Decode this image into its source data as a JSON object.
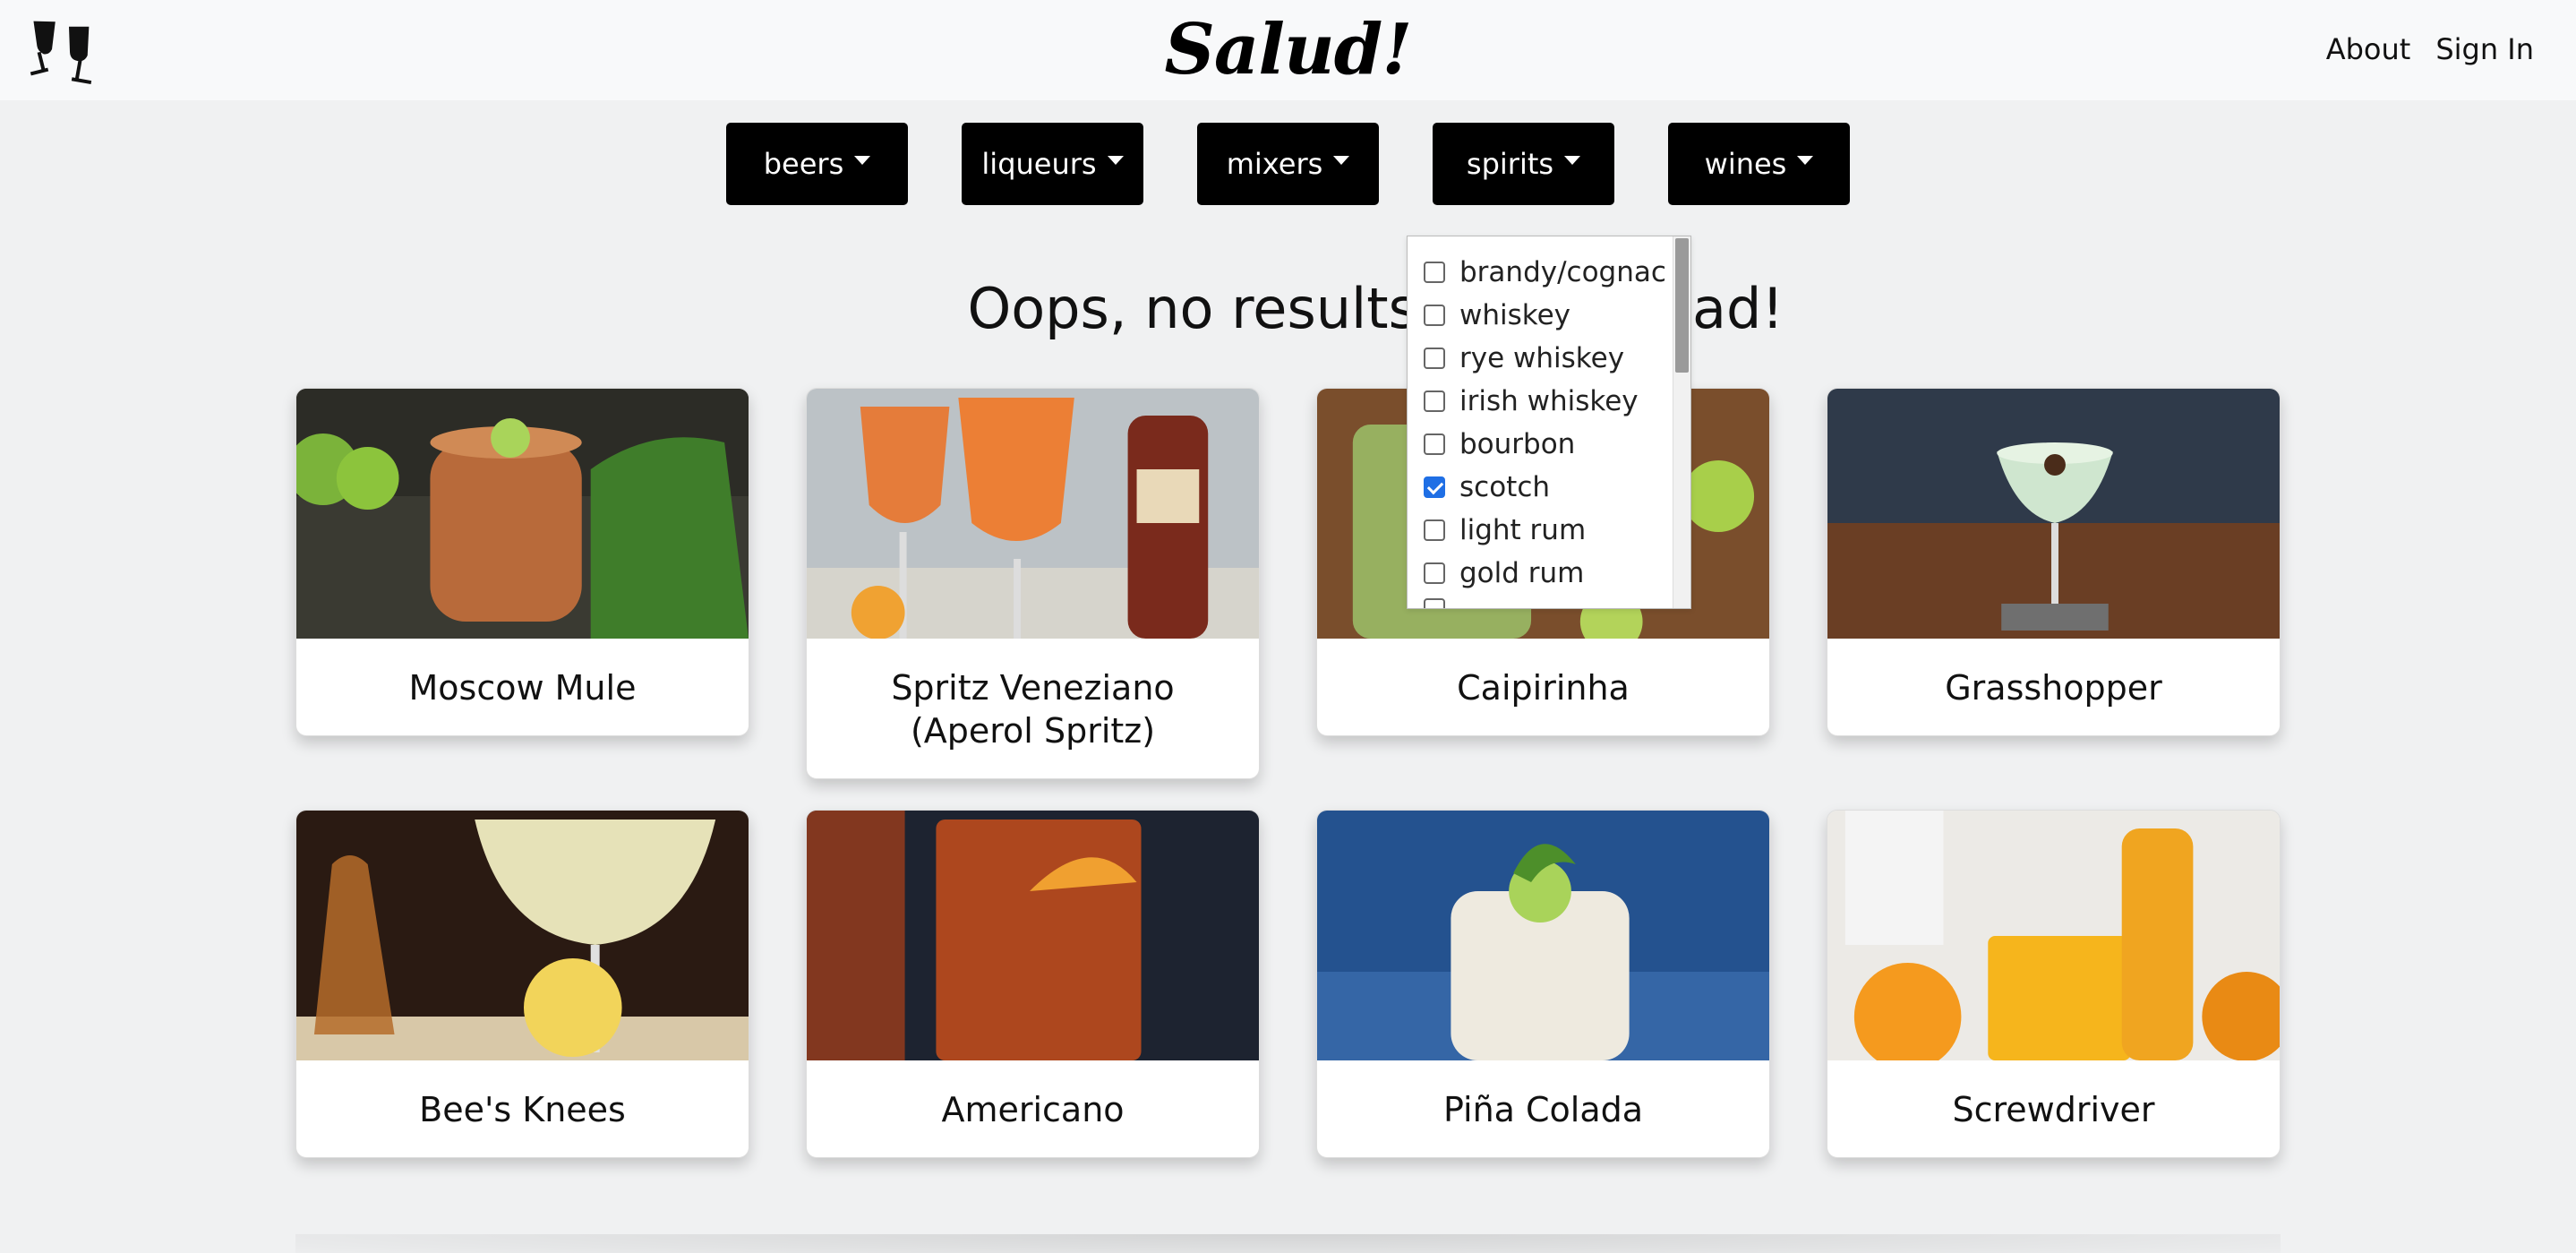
{
  "navbar": {
    "brand": "Salud!",
    "logo_icon": "clinking-glasses-icon",
    "links": [
      "About",
      "Sign In"
    ]
  },
  "filters": [
    {
      "label": "beers"
    },
    {
      "label": "liqueurs"
    },
    {
      "label": "mixers"
    },
    {
      "label": "spirits"
    },
    {
      "label": "wines"
    }
  ],
  "message": "Oops, no results. Try the quad!",
  "message_visible": {
    "left": "Oops, no results. Try th",
    "right": "ad!"
  },
  "dropdown": {
    "options": [
      {
        "label": "brandy/cognac",
        "checked": false
      },
      {
        "label": "whiskey",
        "checked": false
      },
      {
        "label": "rye whiskey",
        "checked": false
      },
      {
        "label": "irish whiskey",
        "checked": false
      },
      {
        "label": "bourbon",
        "checked": false
      },
      {
        "label": "scotch",
        "checked": true
      },
      {
        "label": "light rum",
        "checked": false
      },
      {
        "label": "gold rum",
        "checked": false
      }
    ],
    "accent_color": "#1f6fe5"
  },
  "cards": [
    {
      "title": "Moscow Mule"
    },
    {
      "title": "Spritz Veneziano (Aperol Spritz)"
    },
    {
      "title": "Caipirinha"
    },
    {
      "title": "Grasshopper"
    },
    {
      "title": "Bee's Knees"
    },
    {
      "title": "Americano"
    },
    {
      "title": "Piña Colada"
    },
    {
      "title": "Screwdriver"
    }
  ]
}
